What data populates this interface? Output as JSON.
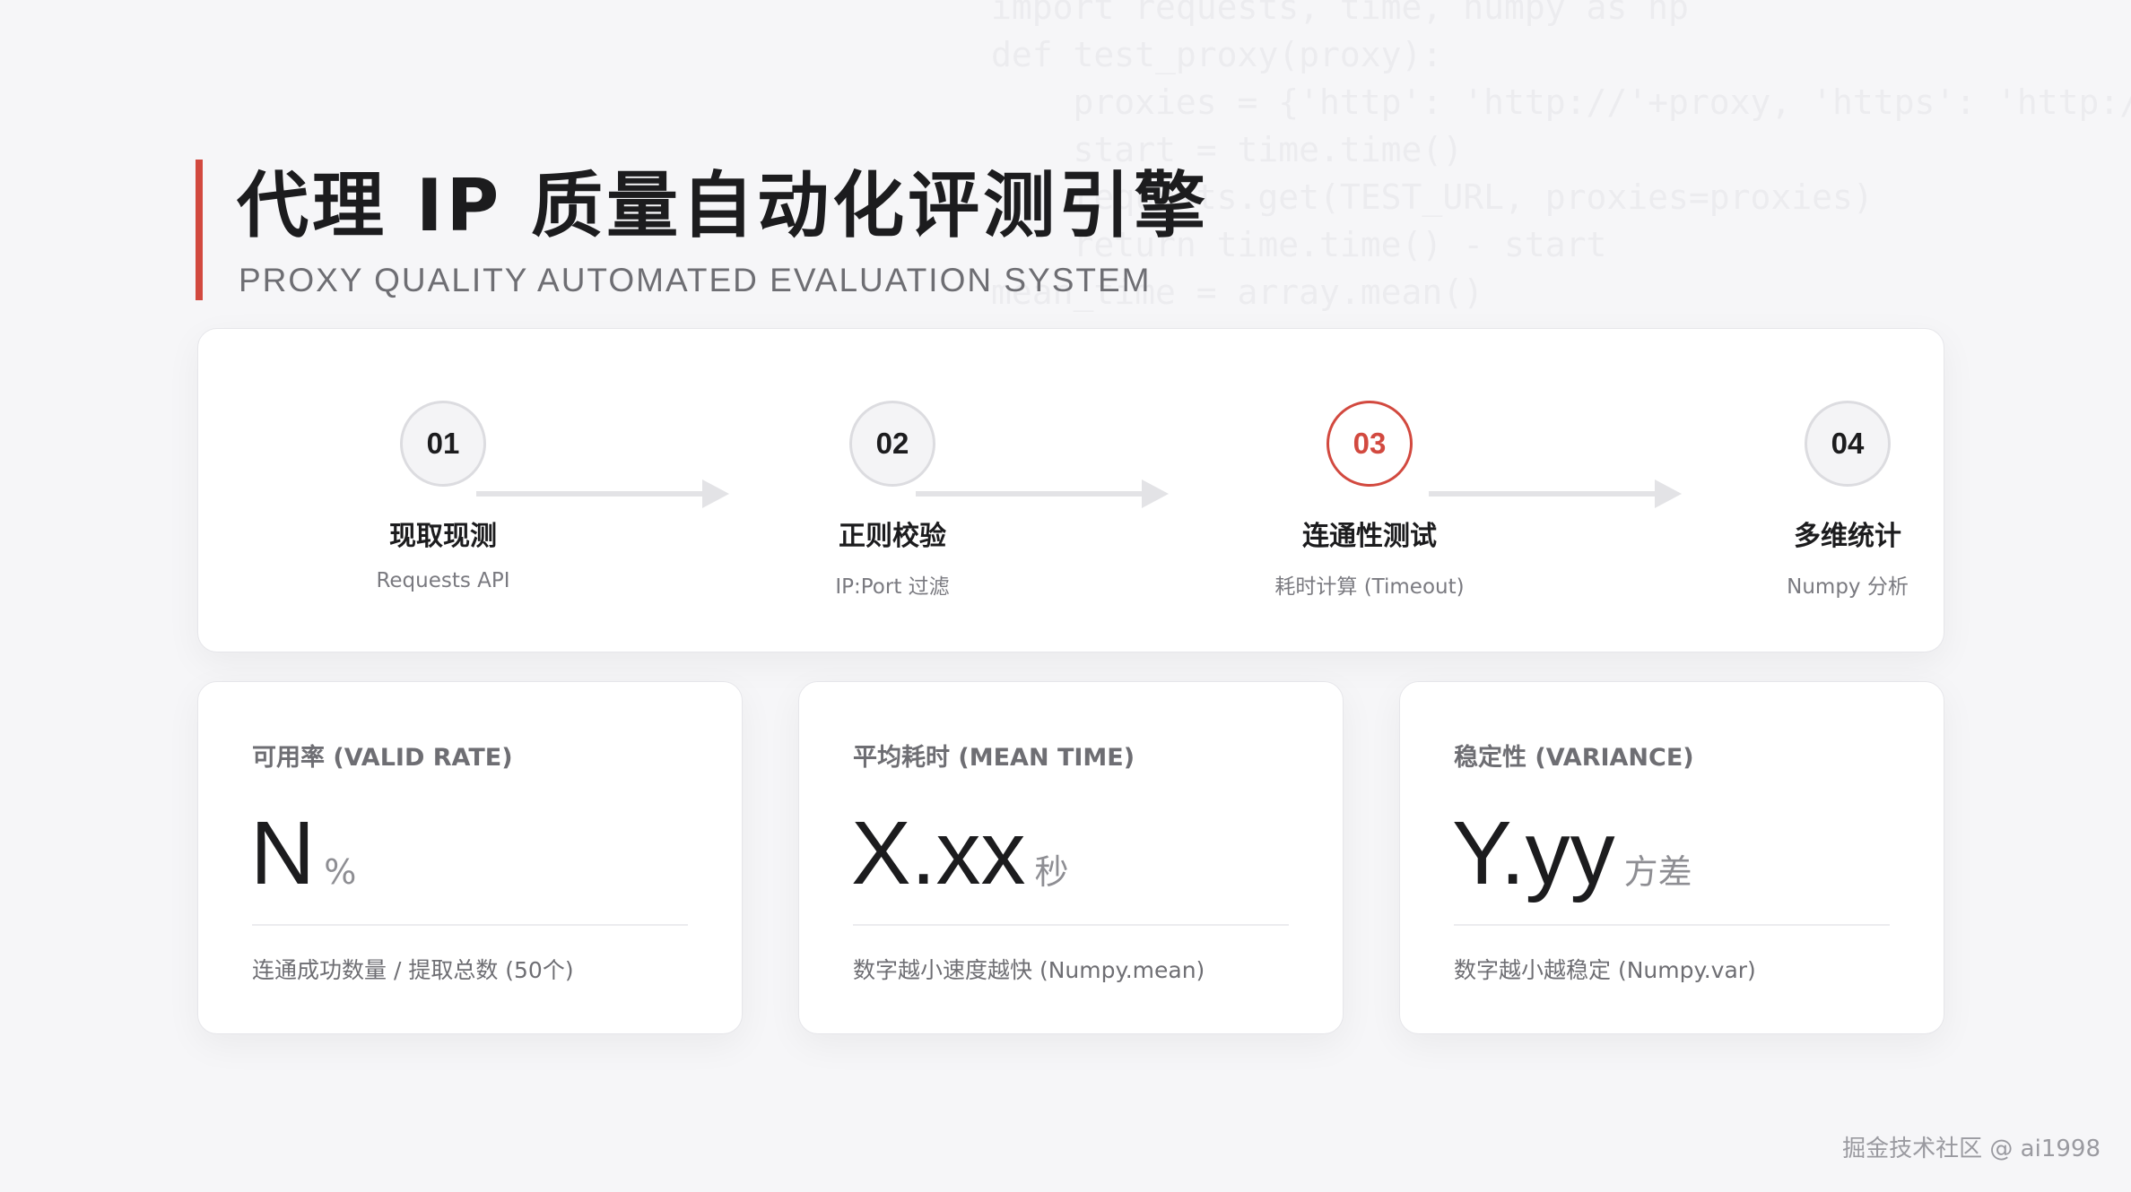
{
  "background_code": [
    "import requests, time, numpy as np",
    "def test_proxy(proxy):",
    "    proxies = {'http': 'http://'+proxy, 'https': 'http://'+proxy}",
    "    start = time.time()",
    "    requests.get(TEST_URL, proxies=proxies)",
    "    return time.time() - start",
    "mean_time = array.mean()"
  ],
  "header": {
    "title": "代理 IP 质量自动化评测引擎",
    "subtitle": "PROXY QUALITY AUTOMATED EVALUATION SYSTEM"
  },
  "pipeline": {
    "active_step": "03",
    "steps": [
      {
        "number": "01",
        "title": "现取现测",
        "desc": "Requests API"
      },
      {
        "number": "02",
        "title": "正则校验",
        "desc": "IP:Port 过滤"
      },
      {
        "number": "03",
        "title": "连通性测试",
        "desc": "耗时计算 (Timeout)"
      },
      {
        "number": "04",
        "title": "多维统计",
        "desc": "Numpy 分析"
      }
    ]
  },
  "metrics": [
    {
      "label": "可用率 (VALID RATE)",
      "value": "N",
      "unit": "%",
      "note": "连通成功数量 / 提取总数 (50个)"
    },
    {
      "label": "平均耗时 (MEAN TIME)",
      "value": "X.xx",
      "unit": "秒",
      "note": "数字越小速度越快 (Numpy.mean)"
    },
    {
      "label": "稳定性 (VARIANCE)",
      "value": "Y.yy",
      "unit": "方差",
      "note": "数字越小越稳定 (Numpy.var)"
    }
  ],
  "colors": {
    "accent": "#d2493f",
    "text_primary": "#1c1c1e",
    "text_secondary": "#6e6e73",
    "arrow": "#e3e3e6"
  },
  "watermark": "掘金技术社区 @ ai1998"
}
